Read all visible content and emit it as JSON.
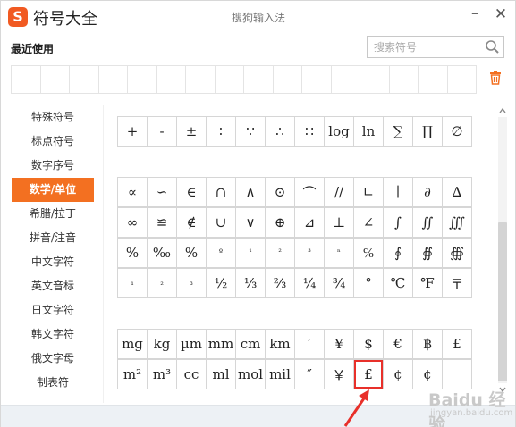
{
  "window": {
    "app_title": "符号大全",
    "ime_title": "搜狗输入法",
    "logo_letter": "S",
    "minimize_symbol": "–",
    "close_symbol": "✕",
    "accent_color": "#f37021"
  },
  "recent": {
    "label": "最近使用",
    "cell_count": 16
  },
  "search": {
    "placeholder": "搜索符号",
    "value": ""
  },
  "sidebar": {
    "items": [
      {
        "label": "特殊符号",
        "active": false
      },
      {
        "label": "标点符号",
        "active": false
      },
      {
        "label": "数字序号",
        "active": false
      },
      {
        "label": "数学/单位",
        "active": true
      },
      {
        "label": "希腊/拉丁",
        "active": false
      },
      {
        "label": "拼音/注音",
        "active": false
      },
      {
        "label": "中文字符",
        "active": false
      },
      {
        "label": "英文音标",
        "active": false
      },
      {
        "label": "日文字符",
        "active": false
      },
      {
        "label": "韩文字符",
        "active": false
      },
      {
        "label": "俄文字母",
        "active": false
      },
      {
        "label": "制表符",
        "active": false
      }
    ]
  },
  "symbol_groups": [
    {
      "rows": [
        [
          "+",
          "-",
          "±",
          "∶",
          "∵",
          "∴",
          "∷",
          "log",
          "ln",
          "∑",
          "∏",
          "∅"
        ]
      ]
    },
    {
      "rows": [
        [
          "∝",
          "∽",
          "∈",
          "∩",
          "∧",
          "⊙",
          "⌒",
          "//",
          "∟",
          "∣",
          "∂",
          "∆"
        ],
        [
          "∞",
          "≌",
          "∉",
          "∪",
          "∨",
          "⊕",
          "⊿",
          "⊥",
          "∠",
          "∫",
          "∬",
          "∭"
        ],
        [
          "%",
          "‰",
          "%",
          "º",
          "¹",
          "²",
          "³",
          "ⁿ",
          "℅",
          "∮",
          "∯",
          "∰"
        ],
        [
          "₁",
          "₂",
          "₃",
          "½",
          "⅓",
          "⅔",
          "¼",
          "¾",
          "°",
          "℃",
          "℉",
          "〒"
        ]
      ]
    },
    {
      "rows": [
        [
          "mg",
          "kg",
          "µm",
          "mm",
          "cm",
          "km",
          "′",
          "¥",
          "$",
          "€",
          "฿",
          "£"
        ],
        [
          "m²",
          "m³",
          "cc",
          "ml",
          "mol",
          "mil",
          "″",
          "￥",
          "£",
          "¢",
          "¢",
          ""
        ]
      ]
    }
  ],
  "highlighted_symbol": "£",
  "watermark": {
    "text": "Baidu 经验",
    "sub": "jingyan.baidu.com"
  },
  "colors": {
    "highlight_border": "#e8302a",
    "arrow": "#e8302a",
    "bottom_bar": "#edf1f5"
  }
}
